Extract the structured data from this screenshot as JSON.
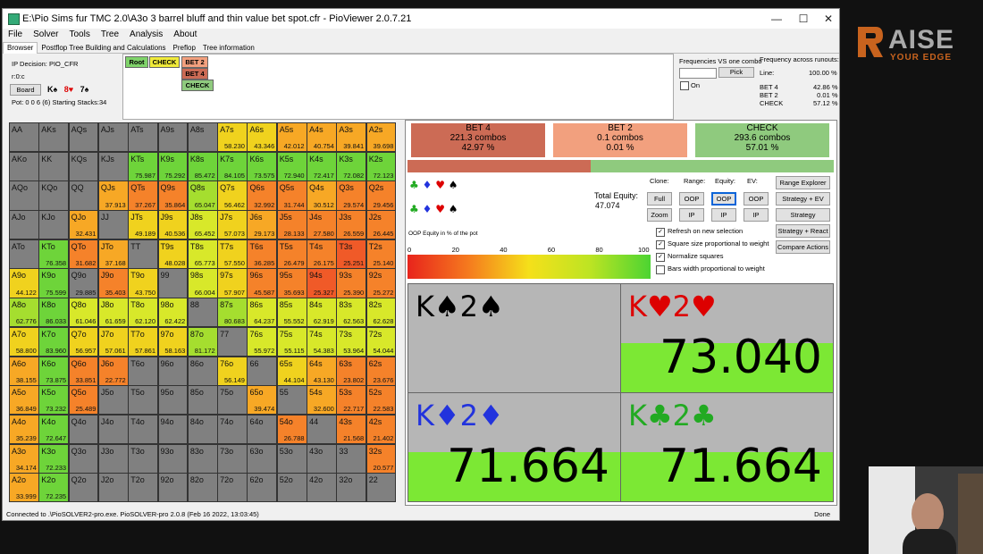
{
  "window": {
    "title": "E:\\Pio Sims fur TMC 2.0\\A3o 3 barrel bluff and thin value bet spot.cfr - PioViewer 2.0.7.21",
    "minimize": "—",
    "maximize": "☐",
    "close": "✕"
  },
  "menu": [
    "File",
    "Solver",
    "Tools",
    "Tree",
    "Analysis",
    "About"
  ],
  "tabs": [
    "Browser",
    "Postflop Tree Building and Calculations",
    "Preflop",
    "Tree information"
  ],
  "info": {
    "ip_decision": "IP Decision:  PIO_CFR",
    "node": "r:0:c",
    "board_button": "Board",
    "board_cards": [
      {
        "t": "K♠",
        "c": "#000"
      },
      {
        "t": "8♥",
        "c": "#d00"
      },
      {
        "t": "7♠",
        "c": "#000"
      }
    ],
    "pot": "Pot: 0 0 6 (6) Starting Stacks:34"
  },
  "tree": {
    "root": "Root",
    "check": "CHECK",
    "bet2": "BET 2",
    "bet4": "BET 4",
    "check2": "CHECK"
  },
  "freq_panel": {
    "vs_label": "Frequencies VS one combo",
    "pick": "Pick",
    "on": "On",
    "runouts_label": "Frequency across runouts:",
    "line_label": "Line:",
    "line_val": "100.00 %",
    "rows": [
      {
        "name": "BET 4",
        "val": "42.86 %"
      },
      {
        "name": "BET 2",
        "val": "0.01 %"
      },
      {
        "name": "CHECK",
        "val": "57.12 %"
      }
    ]
  },
  "actions": [
    {
      "name": "BET 4",
      "combos": "221.3 combos",
      "pct": "42.97 %",
      "color": "#cc6b55"
    },
    {
      "name": "BET 2",
      "combos": "0.1 combos",
      "pct": "0.01 %",
      "color": "#f2a07e"
    },
    {
      "name": "CHECK",
      "combos": "293.6 combos",
      "pct": "57.01 %",
      "color": "#8fca7e"
    }
  ],
  "action_bar": {
    "bet_fraction": 0.43,
    "bet_color": "#cc6b55",
    "check_color": "#8fca7e"
  },
  "controls": {
    "clone": "Clone:",
    "range": "Range:",
    "equity": "Equity:",
    "ev": "EV:",
    "full": "Full",
    "zoom": "Zoom",
    "oop1": "OOP",
    "ip1": "IP",
    "oop2": "OOP",
    "ip2": "IP",
    "oop3": "OOP",
    "ip3": "IP",
    "range_explorer": "Range Explorer",
    "strategy_ev": "Strategy + EV",
    "strategy": "Strategy",
    "strategy_react": "Strategy + React",
    "compare": "Compare Actions"
  },
  "total_equity": {
    "label": "Total Equity:",
    "value": "47.074"
  },
  "checkboxes": [
    {
      "label": "Refresh on new selection",
      "checked": true
    },
    {
      "label": "Square size proportional to weight",
      "checked": true
    },
    {
      "label": "Normalize squares",
      "checked": true
    },
    {
      "label": "Bars width proportional to weight",
      "checked": false
    }
  ],
  "equity_scale": {
    "title": "OOP Equity in % of the pot",
    "ticks": [
      "0",
      "20",
      "40",
      "60",
      "80",
      "100"
    ]
  },
  "hands": [
    {
      "cards": [
        {
          "t": "K♠",
          "c": "#000"
        },
        {
          "t": "2♠",
          "c": "#000"
        }
      ],
      "eq": ""
    },
    {
      "cards": [
        {
          "t": "K♥",
          "c": "#d00"
        },
        {
          "t": "2♥",
          "c": "#d00"
        }
      ],
      "eq": "73.040"
    },
    {
      "cards": [
        {
          "t": "K♦",
          "c": "#2233dd"
        },
        {
          "t": "2♦",
          "c": "#2233dd"
        }
      ],
      "eq": "71.664"
    },
    {
      "cards": [
        {
          "t": "K♣",
          "c": "#22aa22"
        },
        {
          "t": "2♣",
          "c": "#22aa22"
        }
      ],
      "eq": "71.664"
    }
  ],
  "grid": [
    [
      [
        "AA",
        "",
        0
      ],
      [
        "AKs",
        "",
        0
      ],
      [
        "AQs",
        "",
        0
      ],
      [
        "AJs",
        "",
        0
      ],
      [
        "ATs",
        "",
        0
      ],
      [
        "A9s",
        "",
        0
      ],
      [
        "A8s",
        "",
        0
      ],
      [
        "A7s",
        "58.230",
        4
      ],
      [
        "A6s",
        "43.346",
        4
      ],
      [
        "A5s",
        "42.012",
        3
      ],
      [
        "A4s",
        "40.754",
        3
      ],
      [
        "A3s",
        "39.841",
        3
      ],
      [
        "A2s",
        "39.698",
        3
      ]
    ],
    [
      [
        "AKo",
        "",
        0
      ],
      [
        "KK",
        "",
        0
      ],
      [
        "KQs",
        "",
        0
      ],
      [
        "KJs",
        "",
        0
      ],
      [
        "KTs",
        "75.987",
        7
      ],
      [
        "K9s",
        "75.292",
        7
      ],
      [
        "K8s",
        "85.472",
        7
      ],
      [
        "K7s",
        "84.105",
        7
      ],
      [
        "K6s",
        "73.575",
        7
      ],
      [
        "K5s",
        "72.940",
        7
      ],
      [
        "K4s",
        "72.417",
        7
      ],
      [
        "K3s",
        "72.082",
        7
      ],
      [
        "K2s",
        "72.123",
        7
      ]
    ],
    [
      [
        "AQo",
        "",
        0
      ],
      [
        "KQo",
        "",
        0
      ],
      [
        "QQ",
        "",
        0
      ],
      [
        "QJs",
        "37.913",
        3
      ],
      [
        "QTs",
        "37.267",
        2
      ],
      [
        "Q9s",
        "35.864",
        2
      ],
      [
        "Q8s",
        "65.047",
        6
      ],
      [
        "Q7s",
        "56.462",
        4
      ],
      [
        "Q6s",
        "32.992",
        2
      ],
      [
        "Q5s",
        "31.744",
        2
      ],
      [
        "Q4s",
        "30.512",
        3
      ],
      [
        "Q3s",
        "29.574",
        2
      ],
      [
        "Q2s",
        "29.456",
        2
      ]
    ],
    [
      [
        "AJo",
        "",
        0
      ],
      [
        "KJo",
        "",
        0
      ],
      [
        "QJo",
        "32.431",
        3
      ],
      [
        "JJ",
        "",
        0
      ],
      [
        "JTs",
        "49.189",
        4
      ],
      [
        "J9s",
        "40.536",
        4
      ],
      [
        "J8s",
        "65.452",
        5
      ],
      [
        "J7s",
        "57.073",
        4
      ],
      [
        "J6s",
        "29.173",
        3
      ],
      [
        "J5s",
        "28.133",
        2
      ],
      [
        "J4s",
        "27.580",
        2
      ],
      [
        "J3s",
        "26.559",
        2
      ],
      [
        "J2s",
        "26.445",
        2
      ]
    ],
    [
      [
        "ATo",
        "",
        0
      ],
      [
        "KTo",
        "76.358",
        7
      ],
      [
        "QTo",
        "31.682",
        2
      ],
      [
        "JTo",
        "37.168",
        3
      ],
      [
        "TT",
        "",
        0
      ],
      [
        "T9s",
        "48.028",
        4
      ],
      [
        "T8s",
        "65.773",
        5
      ],
      [
        "T7s",
        "57.550",
        4
      ],
      [
        "T6s",
        "36.285",
        2
      ],
      [
        "T5s",
        "26.479",
        2
      ],
      [
        "T4s",
        "26.175",
        2
      ],
      [
        "T3s",
        "25.251",
        1
      ],
      [
        "T2s",
        "25.140",
        2
      ]
    ],
    [
      [
        "A9o",
        "44.122",
        4
      ],
      [
        "K9o",
        "75.599",
        7
      ],
      [
        "Q9o",
        "29.885",
        0
      ],
      [
        "J9o",
        "35.403",
        2
      ],
      [
        "T9o",
        "43.750",
        4
      ],
      [
        "99",
        "",
        0
      ],
      [
        "98s",
        "66.004",
        5
      ],
      [
        "97s",
        "57.907",
        4
      ],
      [
        "96s",
        "45.587",
        2
      ],
      [
        "95s",
        "35.693",
        2
      ],
      [
        "94s",
        "25.327",
        1
      ],
      [
        "93s",
        "25.390",
        2
      ],
      [
        "92s",
        "25.272",
        2
      ]
    ],
    [
      [
        "A8o",
        "62.776",
        6
      ],
      [
        "K8o",
        "86.033",
        7
      ],
      [
        "Q8o",
        "61.046",
        5
      ],
      [
        "J8o",
        "61.659",
        5
      ],
      [
        "T8o",
        "62.120",
        5
      ],
      [
        "98o",
        "62.422",
        5
      ],
      [
        "88",
        "",
        0
      ],
      [
        "87s",
        "80.683",
        6
      ],
      [
        "86s",
        "64.237",
        5
      ],
      [
        "85s",
        "55.552",
        5
      ],
      [
        "84s",
        "62.919",
        5
      ],
      [
        "83s",
        "62.563",
        5
      ],
      [
        "82s",
        "62.628",
        5
      ]
    ],
    [
      [
        "A7o",
        "58.800",
        4
      ],
      [
        "K7o",
        "83.960",
        7
      ],
      [
        "Q7o",
        "56.957",
        4
      ],
      [
        "J7o",
        "57.061",
        4
      ],
      [
        "T7o",
        "57.861",
        4
      ],
      [
        "97o",
        "58.163",
        4
      ],
      [
        "87o",
        "81.172",
        6
      ],
      [
        "77",
        "",
        0
      ],
      [
        "76s",
        "55.972",
        5
      ],
      [
        "75s",
        "55.115",
        5
      ],
      [
        "74s",
        "54.383",
        5
      ],
      [
        "73s",
        "53.964",
        5
      ],
      [
        "72s",
        "54.044",
        5
      ]
    ],
    [
      [
        "A6o",
        "38.155",
        3
      ],
      [
        "K6o",
        "73.875",
        7
      ],
      [
        "Q6o",
        "33.851",
        2
      ],
      [
        "J6o",
        "22.772",
        2
      ],
      [
        "T6o",
        "",
        0
      ],
      [
        "96o",
        "",
        0
      ],
      [
        "86o",
        "",
        0
      ],
      [
        "76o",
        "56.149",
        4
      ],
      [
        "66",
        "",
        0
      ],
      [
        "65s",
        "44.104",
        4
      ],
      [
        "64s",
        "43.130",
        3
      ],
      [
        "63s",
        "23.802",
        2
      ],
      [
        "62s",
        "23.676",
        2
      ]
    ],
    [
      [
        "A5o",
        "36.849",
        3
      ],
      [
        "K5o",
        "73.232",
        7
      ],
      [
        "Q5o",
        "25.489",
        2
      ],
      [
        "J5o",
        "",
        0
      ],
      [
        "T5o",
        "",
        0
      ],
      [
        "95o",
        "",
        0
      ],
      [
        "85o",
        "",
        0
      ],
      [
        "75o",
        "",
        0
      ],
      [
        "65o",
        "39.474",
        3
      ],
      [
        "55",
        "",
        0
      ],
      [
        "54s",
        "32.600",
        3
      ],
      [
        "53s",
        "22.717",
        2
      ],
      [
        "52s",
        "22.583",
        2
      ]
    ],
    [
      [
        "A4o",
        "35.239",
        3
      ],
      [
        "K4o",
        "72.647",
        7
      ],
      [
        "Q4o",
        "",
        0
      ],
      [
        "J4o",
        "",
        0
      ],
      [
        "T4o",
        "",
        0
      ],
      [
        "94o",
        "",
        0
      ],
      [
        "84o",
        "",
        0
      ],
      [
        "74o",
        "",
        0
      ],
      [
        "64o",
        "",
        0
      ],
      [
        "54o",
        "26.788",
        2
      ],
      [
        "44",
        "",
        0
      ],
      [
        "43s",
        "21.568",
        2
      ],
      [
        "42s",
        "21.402",
        2
      ]
    ],
    [
      [
        "A3o",
        "34.174",
        3
      ],
      [
        "K3o",
        "72.233",
        7
      ],
      [
        "Q3o",
        "",
        0
      ],
      [
        "J3o",
        "",
        0
      ],
      [
        "T3o",
        "",
        0
      ],
      [
        "93o",
        "",
        0
      ],
      [
        "83o",
        "",
        0
      ],
      [
        "73o",
        "",
        0
      ],
      [
        "63o",
        "",
        0
      ],
      [
        "53o",
        "",
        0
      ],
      [
        "43o",
        "",
        0
      ],
      [
        "33",
        "",
        0
      ],
      [
        "32s",
        "20.577",
        2
      ]
    ],
    [
      [
        "A2o",
        "33.999",
        3
      ],
      [
        "K2o",
        "72.235",
        7
      ],
      [
        "Q2o",
        "",
        0
      ],
      [
        "J2o",
        "",
        0
      ],
      [
        "T2o",
        "",
        0
      ],
      [
        "92o",
        "",
        0
      ],
      [
        "82o",
        "",
        0
      ],
      [
        "72o",
        "",
        0
      ],
      [
        "62o",
        "",
        0
      ],
      [
        "52o",
        "",
        0
      ],
      [
        "42o",
        "",
        0
      ],
      [
        "32o",
        "",
        0
      ],
      [
        "22",
        "",
        0
      ]
    ]
  ],
  "palette": [
    "#808080",
    "#f05a28",
    "#f5822a",
    "#f7a825",
    "#f0d21e",
    "#d8e82a",
    "#a5de2f",
    "#6ed43a"
  ],
  "status": {
    "left": "Connected to .\\PioSOLVER2-pro.exe. PioSOLVER-pro 2.0.8 (Feb 16 2022, 13:03:45)",
    "right": "Done"
  },
  "logo": {
    "line1": "AISE",
    "line2": "YOUR EDGE"
  }
}
